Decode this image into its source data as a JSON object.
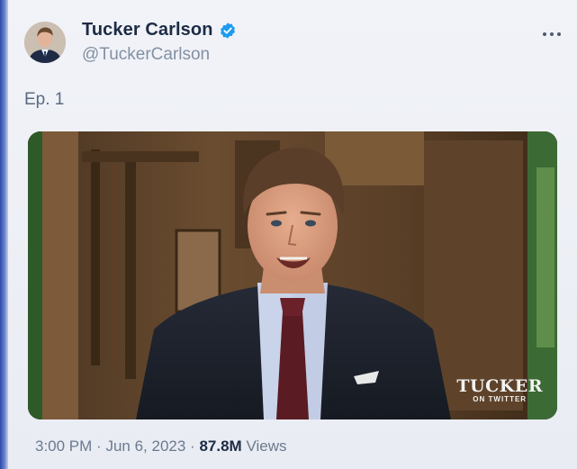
{
  "tweet": {
    "author": {
      "display_name": "Tucker Carlson",
      "handle": "@TuckerCarlson",
      "verified": true,
      "avatar_icon": "profile-photo"
    },
    "text": "Ep. 1",
    "media": {
      "type": "video",
      "watermark_main": "TUCKER",
      "watermark_sub": "ON TWITTER"
    },
    "time": "3:00 PM",
    "separator": "·",
    "date": "Jun 6, 2023",
    "views_count": "87.8M",
    "views_label": "Views"
  },
  "colors": {
    "verified_badge": "#1d9bf0",
    "name_text": "#1d2b45",
    "muted_text": "#8390a3"
  }
}
